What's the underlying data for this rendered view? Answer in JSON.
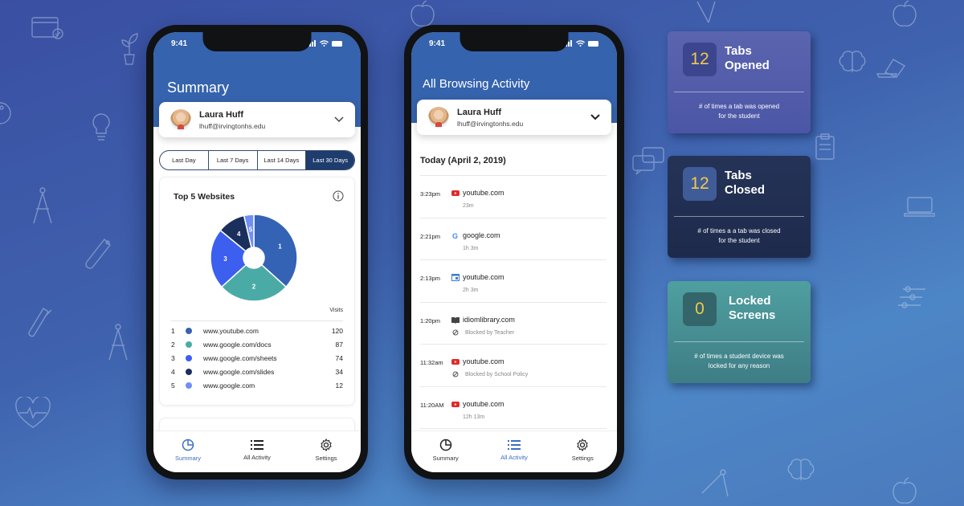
{
  "colors": {
    "header_blue": "#3563ad",
    "segment_active": "#1f3c6e",
    "tab_active": "#3a6ec4",
    "stat_number": "#f2c94c"
  },
  "phone_summary": {
    "status_time": "9:41",
    "title": "Summary",
    "user": {
      "name": "Laura Huff",
      "email": "lhuff@irvingtonhs.edu"
    },
    "ranges": [
      "Last Day",
      "Last 7 Days",
      "Last 14 Days",
      "Last 30 Days"
    ],
    "selected_range": "Last 30 Days",
    "top_sites": {
      "title": "Top 5 Websites",
      "visits_label": "Visits",
      "rows": [
        {
          "rank": "1",
          "site": "www.youtube.com",
          "visits": "120",
          "color": "#3462b4"
        },
        {
          "rank": "2",
          "site": "www.google.com/docs",
          "visits": "87",
          "color": "#4aaba6"
        },
        {
          "rank": "3",
          "site": "www.google.com/sheets",
          "visits": "74",
          "color": "#3c5ff0"
        },
        {
          "rank": "4",
          "site": "www.google.com/slides",
          "visits": "34",
          "color": "#1b2f5c"
        },
        {
          "rank": "5",
          "site": "www.google.com",
          "visits": "12",
          "color": "#6f8ff2"
        }
      ]
    },
    "tabs": [
      "Summary",
      "All Activity",
      "Settings"
    ],
    "active_tab": "Summary"
  },
  "chart_data": {
    "type": "pie",
    "title": "Top 5 Websites",
    "donut": true,
    "categories": [
      "1",
      "2",
      "3",
      "4",
      "5"
    ],
    "labels": [
      "www.youtube.com",
      "www.google.com/docs",
      "www.google.com/sheets",
      "www.google.com/slides",
      "www.google.com"
    ],
    "values": [
      120,
      87,
      74,
      34,
      12
    ],
    "colors": [
      "#3462b4",
      "#4aaba6",
      "#3c5ff0",
      "#1b2f5c",
      "#6f8ff2"
    ],
    "legend": "below",
    "value_label": "Visits"
  },
  "phone_activity": {
    "status_time": "9:41",
    "title": "All Browsing Activity",
    "user": {
      "name": "Laura Huff",
      "email": "lhuff@irvingtonhs.edu"
    },
    "date_header": "Today (April 2, 2019)",
    "items": [
      {
        "time": "3:23pm",
        "icon": "youtube-icon",
        "site": "youtube.com",
        "detail": "23m",
        "blocked": false
      },
      {
        "time": "2:21pm",
        "icon": "google-icon",
        "site": "google.com",
        "detail": "1h 3m",
        "blocked": false
      },
      {
        "time": "2:13pm",
        "icon": "calendar-icon",
        "site": "youtube.com",
        "detail": "2h 3m",
        "blocked": false
      },
      {
        "time": "1:20pm",
        "icon": "book-icon",
        "site": "idiomlibrary.com",
        "detail": "Blocked by Teacher",
        "blocked": true
      },
      {
        "time": "11:32am",
        "icon": "youtube-icon",
        "site": "youtube.com",
        "detail": "Blocked by School Policy",
        "blocked": true
      },
      {
        "time": "11:20AM",
        "icon": "youtube-icon",
        "site": "youtube.com",
        "detail": "12h 13m",
        "blocked": false
      }
    ],
    "tabs": [
      "Summary",
      "All Activity",
      "Settings"
    ],
    "active_tab": "All Activity"
  },
  "stats": [
    {
      "value": "12",
      "title_line1": "Tabs",
      "title_line2": "Opened",
      "description": "# of times a tab was opened for the student",
      "bg": "linear-gradient(180deg,#5b64ae,#4b56a6)",
      "box": "#3b468f"
    },
    {
      "value": "12",
      "title_line1": "Tabs",
      "title_line2": "Closed",
      "description": "# of times a a tab was closed for the student",
      "bg": "linear-gradient(180deg,#243357,#1e2a4c)",
      "box": "#3f5c99"
    },
    {
      "value": "0",
      "title_line1": "Locked",
      "title_line2": "Screens",
      "description": "# of times a student device was locked for any reason",
      "bg": "linear-gradient(180deg,#4f9fa0,#3e7d85)",
      "box": "#33656a"
    }
  ]
}
